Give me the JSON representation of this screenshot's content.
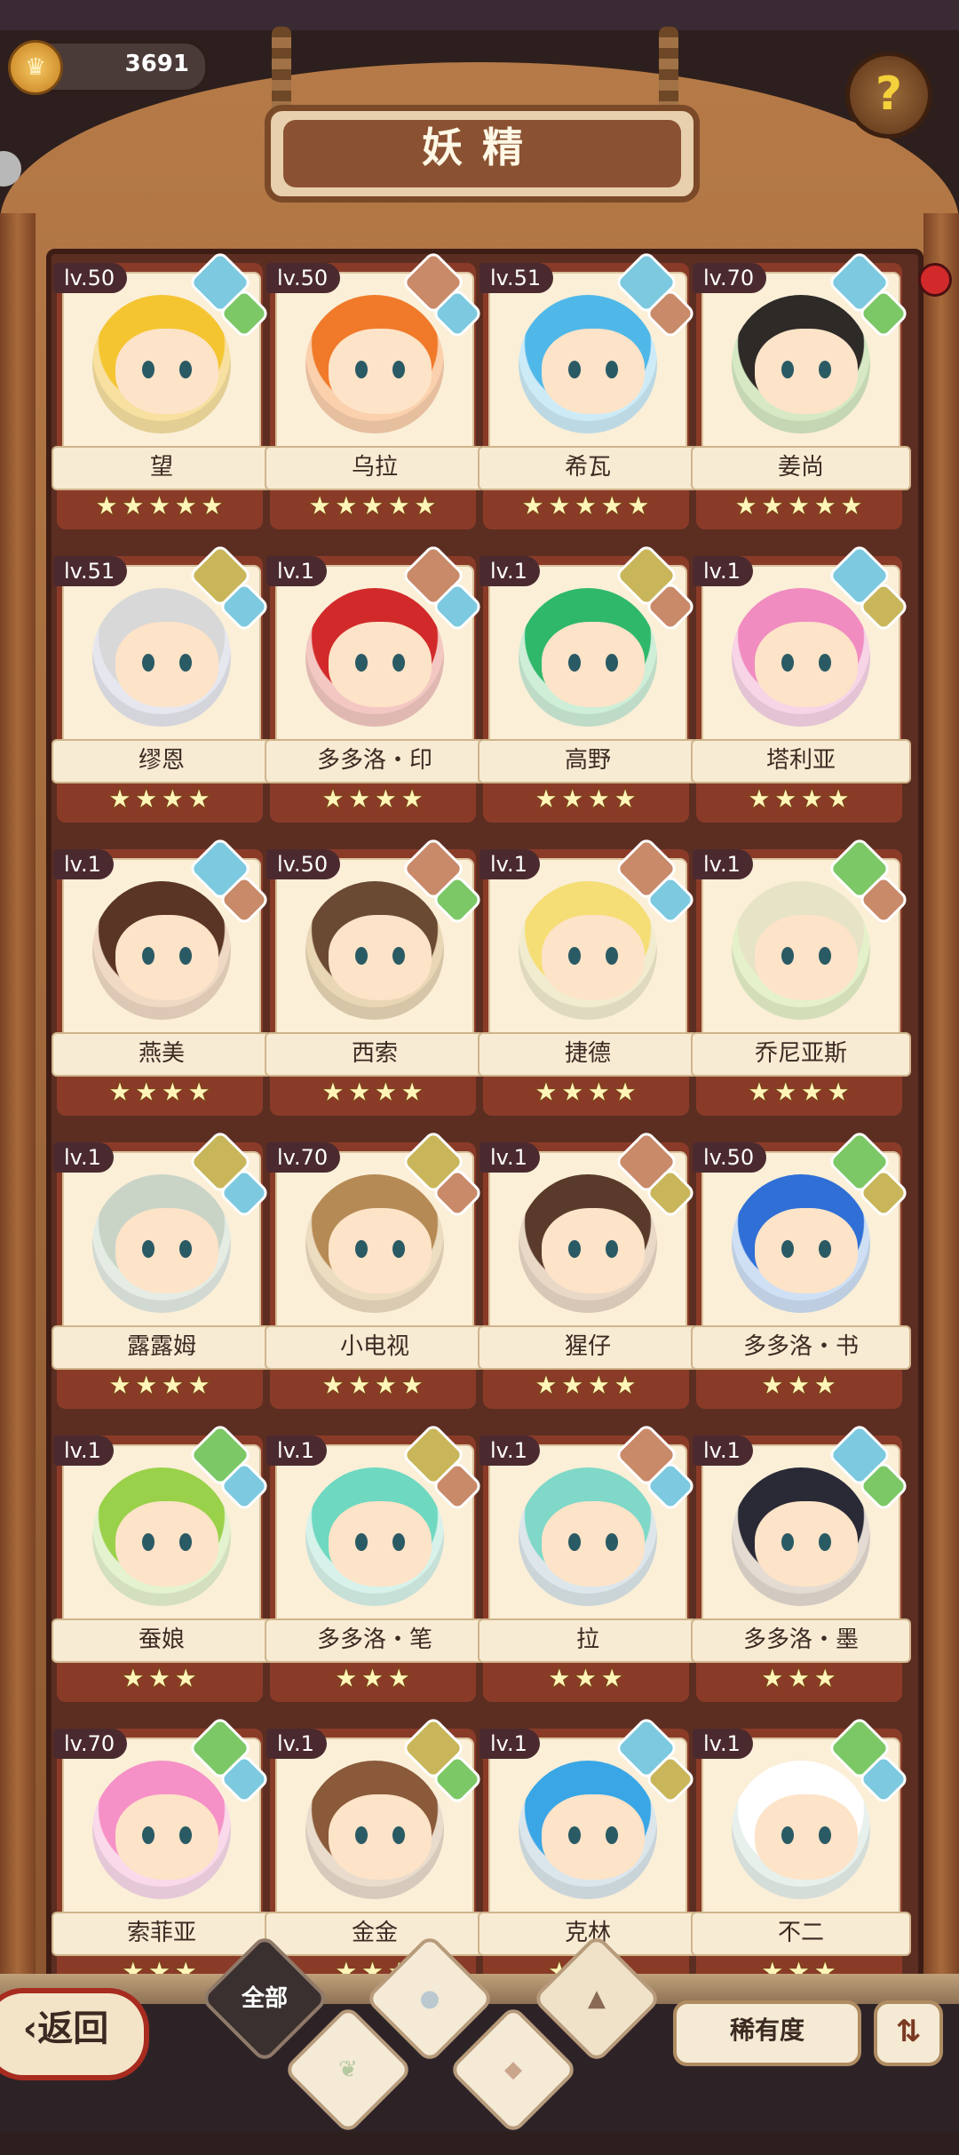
{
  "header": {
    "title": "妖精",
    "coins": "3691",
    "help_label": "?"
  },
  "spirits": [
    {
      "name": "望",
      "level": "lv.50",
      "stars": 5,
      "hair": "#f4c531",
      "bg": "#f7e0a0",
      "badges": [
        "water",
        "leaf"
      ]
    },
    {
      "name": "乌拉",
      "level": "lv.50",
      "stars": 5,
      "hair": "#f07a2a",
      "bg": "#fad0ad",
      "badges": [
        "earth",
        "water"
      ]
    },
    {
      "name": "希瓦",
      "level": "lv.51",
      "stars": 5,
      "hair": "#4fb8e8",
      "bg": "#cdebf7",
      "badges": [
        "water",
        "earth"
      ]
    },
    {
      "name": "姜尚",
      "level": "lv.70",
      "stars": 5,
      "hair": "#2e2a28",
      "bg": "#d6e9c4",
      "badges": [
        "water",
        "leaf"
      ]
    },
    {
      "name": "缪恩",
      "level": "lv.51",
      "stars": 4,
      "hair": "#d8d8d8",
      "bg": "#e6e6ee",
      "badges": [
        "sand",
        "water"
      ]
    },
    {
      "name": "多多洛・印",
      "level": "lv.1",
      "stars": 4,
      "hair": "#d22a2a",
      "bg": "#f4c8c2",
      "badges": [
        "earth",
        "water"
      ]
    },
    {
      "name": "高野",
      "level": "lv.1",
      "stars": 4,
      "hair": "#2fb86a",
      "bg": "#cfeed8",
      "badges": [
        "sand",
        "earth"
      ]
    },
    {
      "name": "塔利亚",
      "level": "lv.1",
      "stars": 4,
      "hair": "#f08cc0",
      "bg": "#f7d4e6",
      "badges": [
        "water",
        "sand"
      ]
    },
    {
      "name": "燕美",
      "level": "lv.1",
      "stars": 4,
      "hair": "#5a3526",
      "bg": "#efd9c4",
      "badges": [
        "water",
        "earth"
      ]
    },
    {
      "name": "西索",
      "level": "lv.50",
      "stars": 4,
      "hair": "#6b4a33",
      "bg": "#e9d6b5",
      "badges": [
        "earth",
        "leaf"
      ]
    },
    {
      "name": "捷德",
      "level": "lv.1",
      "stars": 4,
      "hair": "#f6de76",
      "bg": "#f1ecd0",
      "badges": [
        "earth",
        "water"
      ]
    },
    {
      "name": "乔尼亚斯",
      "level": "lv.1",
      "stars": 4,
      "hair": "#e6e3c7",
      "bg": "#e5f1c9",
      "badges": [
        "leaf",
        "earth"
      ]
    },
    {
      "name": "露露姆",
      "level": "lv.1",
      "stars": 4,
      "hair": "#c9d4c7",
      "bg": "#e4ece4",
      "badges": [
        "sand",
        "water"
      ]
    },
    {
      "name": "小电视",
      "level": "lv.70",
      "stars": 4,
      "hair": "#b68a55",
      "bg": "#ecdcc0",
      "badges": [
        "sand",
        "earth"
      ]
    },
    {
      "name": "猩仔",
      "level": "lv.1",
      "stars": 4,
      "hair": "#5a3a2a",
      "bg": "#ead8c6",
      "badges": [
        "earth",
        "sand"
      ]
    },
    {
      "name": "多多洛・书",
      "level": "lv.50",
      "stars": 3,
      "hair": "#2f6fd6",
      "bg": "#cfe0f4",
      "badges": [
        "leaf",
        "sand"
      ]
    },
    {
      "name": "蚕娘",
      "level": "lv.1",
      "stars": 3,
      "hair": "#9ad14a",
      "bg": "#e5f2cf",
      "badges": [
        "leaf",
        "water"
      ]
    },
    {
      "name": "多多洛・笔",
      "level": "lv.1",
      "stars": 3,
      "hair": "#6fd8c0",
      "bg": "#d7f2ea",
      "badges": [
        "sand",
        "earth"
      ]
    },
    {
      "name": "拉",
      "level": "lv.1",
      "stars": 3,
      "hair": "#7fd8c8",
      "bg": "#dde6ea",
      "badges": [
        "earth",
        "water"
      ]
    },
    {
      "name": "多多洛・墨",
      "level": "lv.1",
      "stars": 3,
      "hair": "#2a2a36",
      "bg": "#e4dcd2",
      "badges": [
        "water",
        "leaf"
      ]
    },
    {
      "name": "索菲亚",
      "level": "lv.70",
      "stars": 3,
      "hair": "#f591c6",
      "bg": "#f9d9ea",
      "badges": [
        "leaf",
        "water"
      ]
    },
    {
      "name": "金金",
      "level": "lv.1",
      "stars": 3,
      "hair": "#8a5a3a",
      "bg": "#e9dccd",
      "badges": [
        "sand",
        "leaf"
      ]
    },
    {
      "name": "克林",
      "level": "lv.1",
      "stars": 3,
      "hair": "#3aa6e6",
      "bg": "#dbe6ec",
      "badges": [
        "water",
        "sand"
      ]
    },
    {
      "name": "不二",
      "level": "lv.1",
      "stars": 3,
      "hair": "#ffffff",
      "bg": "#e8f0ec",
      "badges": [
        "leaf",
        "water"
      ]
    }
  ],
  "badge_colors": {
    "water": "#7cc9e0",
    "leaf": "#7cc866",
    "earth": "#c98a6a",
    "sand": "#c9b65a"
  },
  "filters": {
    "all_label": "全部",
    "items": [
      "leaf",
      "water",
      "earth",
      "mountain"
    ]
  },
  "footer": {
    "back_label": "返回",
    "back_icon": "chevron-left",
    "sort_label": "稀有度",
    "order_icon": "sort-icon"
  }
}
